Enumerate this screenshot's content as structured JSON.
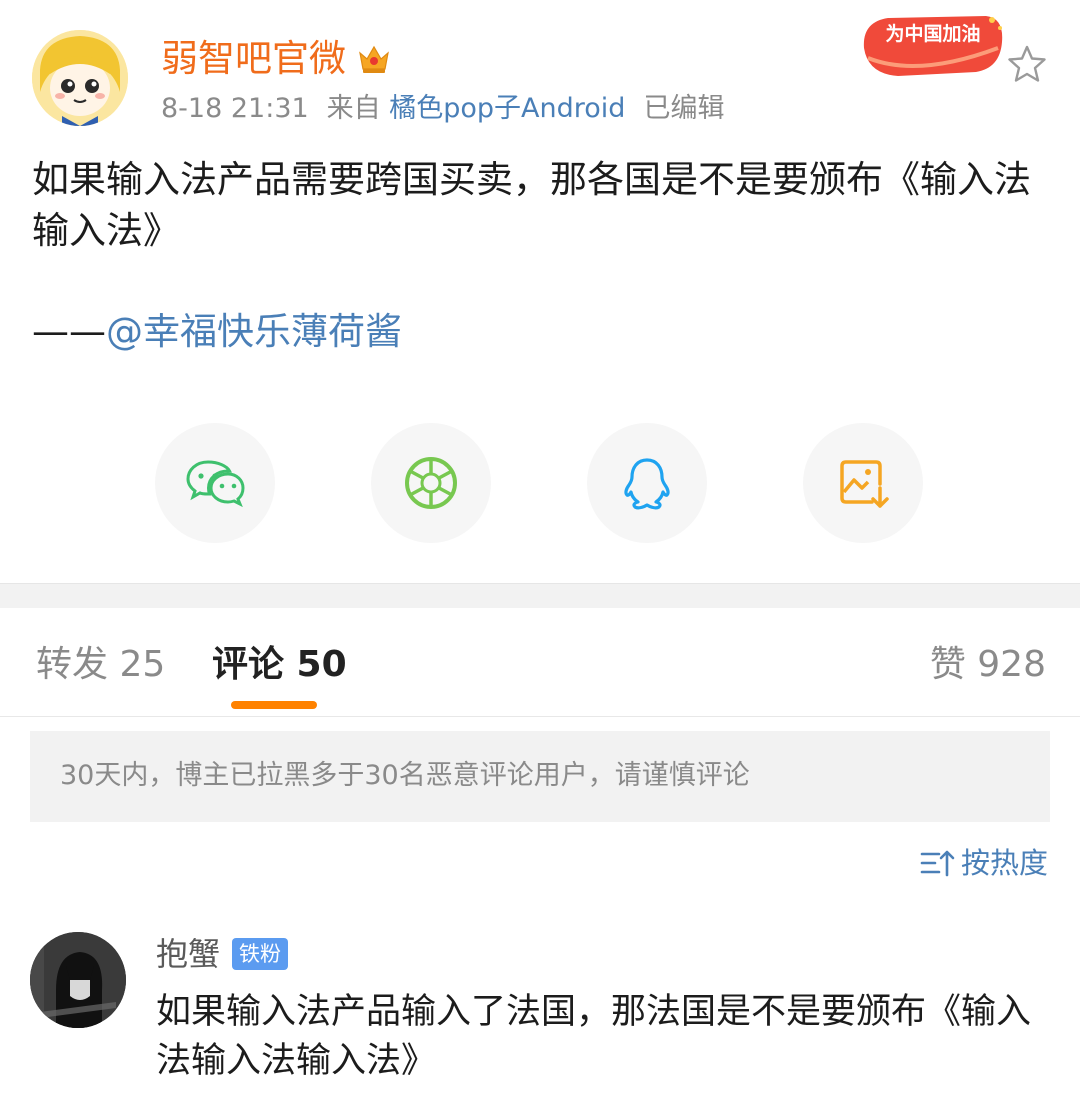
{
  "colors": {
    "author": "#f06c1b",
    "link": "#4a7fb7",
    "tab_accent": "#ff8200",
    "badge_blue": "#5b9bf0",
    "muted": "#8a8a8a"
  },
  "post": {
    "author": "弱智吧官微",
    "author_badge_icon": "crown-icon",
    "time": "8-18 21:31",
    "source_prefix": "来自",
    "source": "橘色pop子Android",
    "edited": "已编辑",
    "promo_badge_text": "为中国加油",
    "text": "如果输入法产品需要跨国买卖，那各国是不是要颁布《输入法输入法》",
    "credit_dash": "——",
    "credit_mention": "@幸福快乐薄荷酱"
  },
  "share": {
    "items": [
      {
        "name": "wechat-share",
        "icon": "wechat-icon"
      },
      {
        "name": "moments-share",
        "icon": "moments-icon"
      },
      {
        "name": "qq-share",
        "icon": "qq-icon"
      },
      {
        "name": "save-image",
        "icon": "save-image-icon"
      }
    ]
  },
  "tabs": {
    "repost": "转发 25",
    "comment": "评论 50",
    "like": "赞 928"
  },
  "notice": "30天内，博主已拉黑多于30名恶意评论用户，请谨慎评论",
  "sort_label": "按热度",
  "comments": [
    {
      "user": "抱蟹",
      "badge": "铁粉",
      "text": "如果输入法产品输入了法国，那法国是不是要颁布《输入法输入法输入法》"
    }
  ]
}
